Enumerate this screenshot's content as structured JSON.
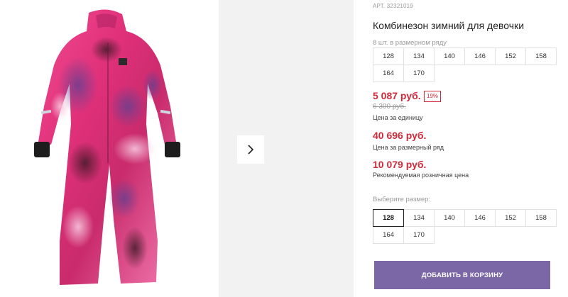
{
  "product": {
    "article": "АРТ. 32321019",
    "title": "Комбинезон зимний для девочки",
    "image_icon": "pink-winter-jumpsuit-image"
  },
  "size_row": {
    "label": "8 шт. в размерном ряду",
    "sizes": [
      "128",
      "134",
      "140",
      "146",
      "152",
      "158",
      "164",
      "170"
    ]
  },
  "pricing": {
    "unit_price": "5 087 руб.",
    "discount_badge": "19%",
    "old_price": "6 300 руб.",
    "unit_caption": "Цена за единицу",
    "row_price": "40 696 руб.",
    "row_caption": "Цена за размерный ряд",
    "retail_price": "10 079 руб.",
    "retail_caption": "Рекомендуемая розничная цена"
  },
  "size_select": {
    "label": "Выберите размер:",
    "sizes": [
      "128",
      "134",
      "140",
      "146",
      "152",
      "158",
      "164",
      "170"
    ],
    "selected": "128"
  },
  "actions": {
    "add_to_cart": "ДОБАВИТЬ В КОРЗИНУ"
  },
  "gallery": {
    "next_icon": "chevron-right-icon"
  },
  "colors": {
    "accent": "#7b66a6",
    "price_red": "#d0293a",
    "product_pink": "#e8317a"
  }
}
